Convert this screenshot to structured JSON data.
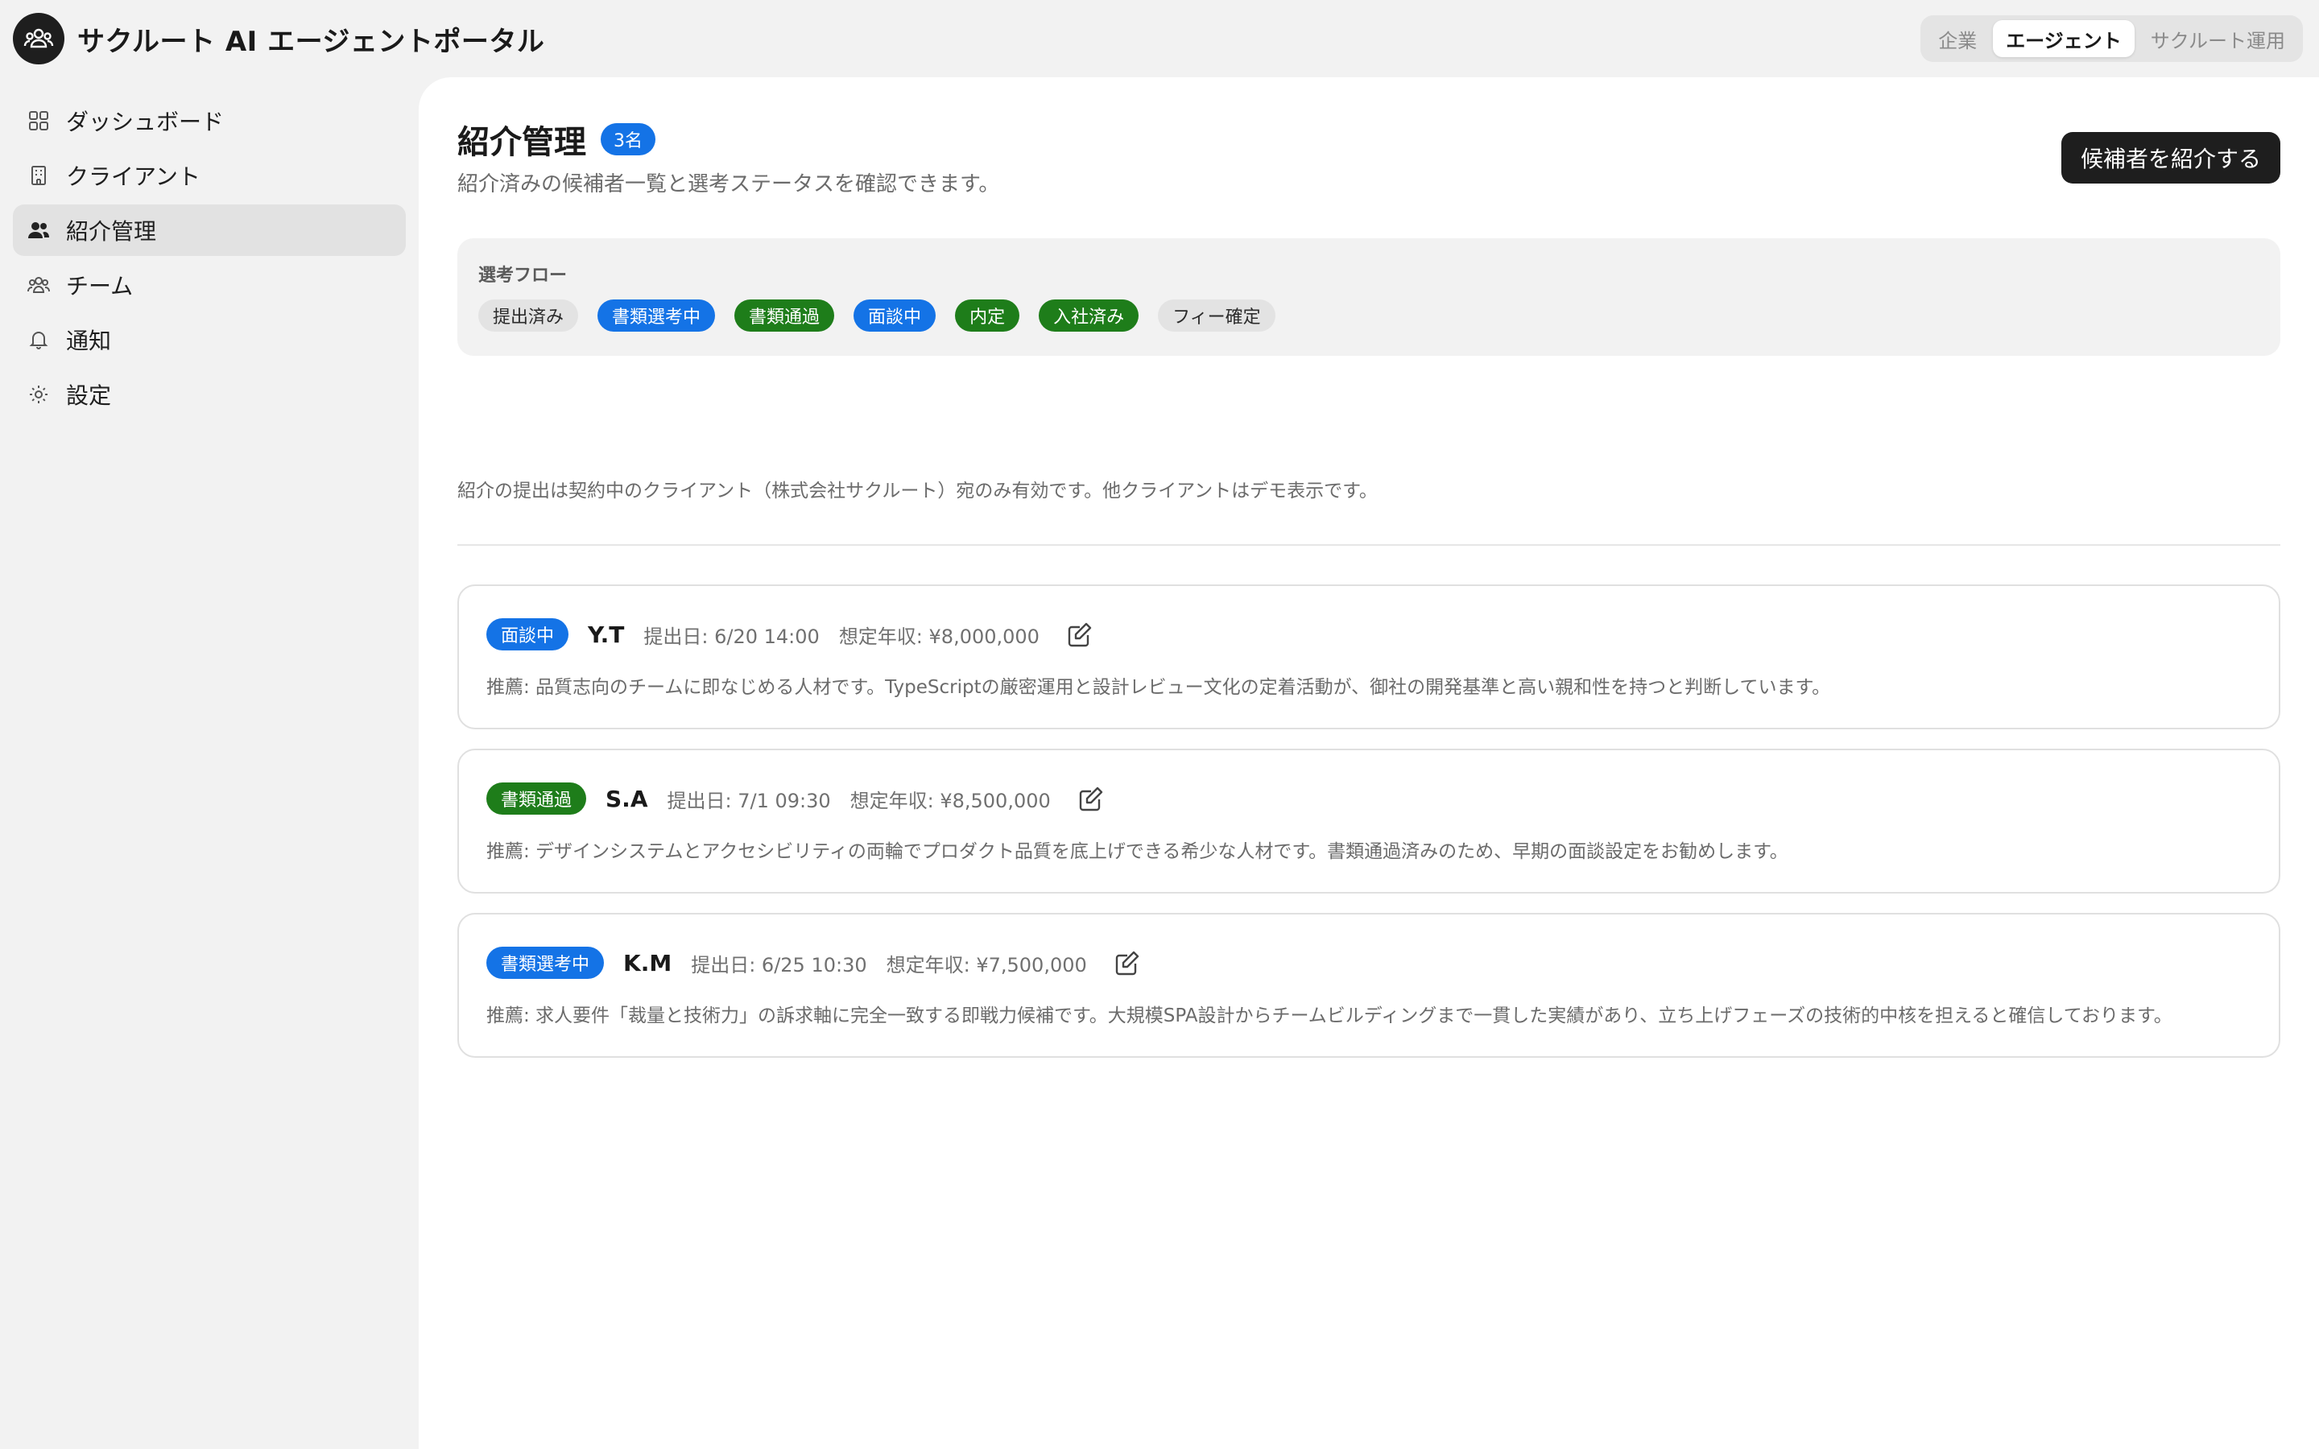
{
  "app": {
    "title": "サクルート AI エージェントポータル",
    "logo_icon": "people-group-icon"
  },
  "role_switch": [
    {
      "label": "企業",
      "active": false
    },
    {
      "label": "エージェント",
      "active": true
    },
    {
      "label": "サクルート運用",
      "active": false
    }
  ],
  "sidebar": {
    "items": [
      {
        "label": "ダッシュボード",
        "icon": "dashboard-grid-icon",
        "active": false
      },
      {
        "label": "クライアント",
        "icon": "building-icon",
        "active": false
      },
      {
        "label": "紹介管理",
        "icon": "users-icon",
        "active": true
      },
      {
        "label": "チーム",
        "icon": "team-icon",
        "active": false
      },
      {
        "label": "通知",
        "icon": "bell-icon",
        "active": false
      },
      {
        "label": "設定",
        "icon": "gear-icon",
        "active": false
      }
    ]
  },
  "page": {
    "title": "紹介管理",
    "count_badge": "3名",
    "subtitle": "紹介済みの候補者一覧と選考ステータスを確認できます。",
    "primary_button": "候補者を紹介する",
    "notice": "紹介の提出は契約中のクライアント（株式会社サクルート）宛のみ有効です。他クライアントはデモ表示です。"
  },
  "flow": {
    "label": "選考フロー",
    "steps": [
      {
        "label": "提出済み",
        "color": "gray"
      },
      {
        "label": "書類選考中",
        "color": "blue"
      },
      {
        "label": "書類通過",
        "color": "green"
      },
      {
        "label": "面談中",
        "color": "blue"
      },
      {
        "label": "内定",
        "color": "green"
      },
      {
        "label": "入社済み",
        "color": "green"
      },
      {
        "label": "フィー確定",
        "color": "gray"
      }
    ]
  },
  "referrals": [
    {
      "status": "面談中",
      "status_color": "blue",
      "name": "Y.T",
      "submitted": "提出日: 6/20 14:00",
      "salary": "想定年収: ¥8,000,000",
      "recommendation": "推薦: 品質志向のチームに即なじめる人材です。TypeScriptの厳密運用と設計レビュー文化の定着活動が、御社の開発基準と高い親和性を持つと判断しています。"
    },
    {
      "status": "書類通過",
      "status_color": "green",
      "name": "S.A",
      "submitted": "提出日: 7/1 09:30",
      "salary": "想定年収: ¥8,500,000",
      "recommendation": "推薦: デザインシステムとアクセシビリティの両輪でプロダクト品質を底上げできる希少な人材です。書類通過済みのため、早期の面談設定をお勧めします。"
    },
    {
      "status": "書類選考中",
      "status_color": "blue",
      "name": "K.M",
      "submitted": "提出日: 6/25 10:30",
      "salary": "想定年収: ¥7,500,000",
      "recommendation": "推薦: 求人要件「裁量と技術力」の訴求軸に完全一致する即戦力候補です。大規模SPA設計からチームビルディングまで一貫した実績があり、立ち上げフェーズの技術的中核を担えると確信しております。"
    }
  ],
  "colors": {
    "blue": "#1473e6",
    "green": "#1e7d1a",
    "gray": "#e3e3e3",
    "dark": "#1e1e1e"
  }
}
